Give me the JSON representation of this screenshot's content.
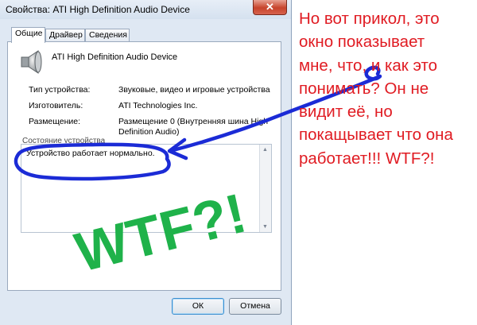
{
  "window": {
    "title": "Свойства: ATI High Definition Audio Device",
    "close_label": "✕",
    "tabs": [
      {
        "label": "Общие",
        "active": true
      },
      {
        "label": "Драйвер",
        "active": false
      },
      {
        "label": "Сведения",
        "active": false
      }
    ],
    "device_icon": "speaker-icon",
    "device_name": "ATI High Definition Audio Device",
    "properties": [
      {
        "label": "Тип устройства:",
        "value": "Звуковые, видео и игровые устройства"
      },
      {
        "label": "Изготовитель:",
        "value": "ATI Technologies Inc."
      },
      {
        "label": "Размещение:",
        "value": "Размещение 0 (Внутренняя шина High",
        "value_line2": "Definition Audio)"
      }
    ],
    "status": {
      "group_label": "Состояние устройства",
      "text": "Устройство работает нормально."
    },
    "buttons": {
      "ok": "ОК",
      "cancel": "Отмена"
    }
  },
  "annotation": {
    "lines": [
      "Но вот прикол, это",
      "окно показывает",
      "мне, что, и как это",
      "понимать? Он не",
      "видит её, но",
      "покащывает что она",
      "работает!!! WTF?!"
    ],
    "scrawl": "WTF?!",
    "colors": {
      "text": "#e01b22",
      "scrawl": "#1fb24a",
      "ink": "#1b2bd6"
    }
  }
}
